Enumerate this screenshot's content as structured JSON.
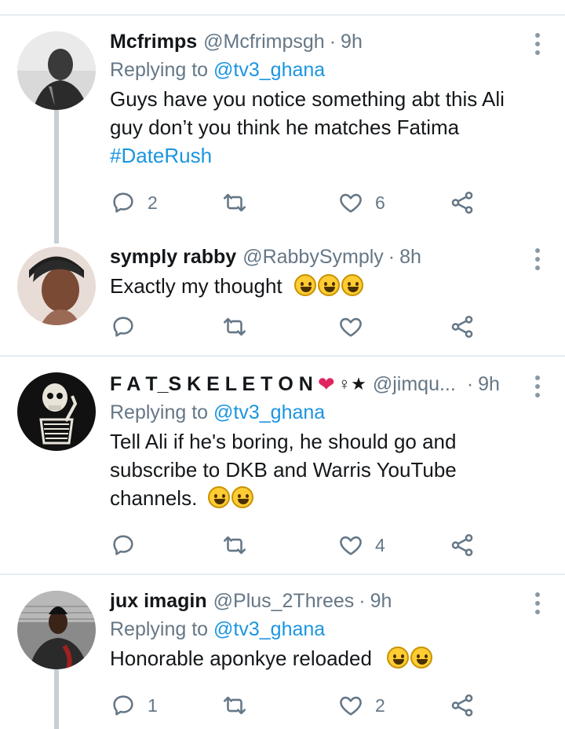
{
  "tweets": [
    {
      "name": "Mcfrimps",
      "handle": "@Mcfrimpsgh",
      "time": "9h",
      "reply_prefix": "Replying to",
      "reply_to": "@tv3_ghana",
      "text": "Guys have you notice something abt this Ali guy don’t you think he matches Fatima",
      "hashtag": "#DateRush",
      "replies": "2",
      "retweets": "",
      "likes": "6"
    },
    {
      "name": "symply rabby",
      "handle": "@RabbySymply",
      "time": "8h",
      "text": "Exactly my thought",
      "emojis": [
        "rofl",
        "rofl",
        "rofl"
      ],
      "replies": "",
      "retweets": "",
      "likes": ""
    },
    {
      "name": "F A T_S K E L E T O N",
      "name_symbols": "♀★",
      "handle": "@jimqu...",
      "time": "9h",
      "reply_prefix": "Replying to",
      "reply_to": "@tv3_ghana",
      "text_lines": [
        "Tell Ali if he's boring, he should go and",
        "subscribe to DKB and Warris YouTube",
        "channels."
      ],
      "emojis": [
        "rofl",
        "rofl"
      ],
      "replies": "",
      "retweets": "",
      "likes": "4"
    },
    {
      "name": "jux imagin",
      "handle": "@Plus_2Threes",
      "time": "9h",
      "reply_prefix": "Replying to",
      "reply_to": "@tv3_ghana",
      "text": "Honorable aponkye reloaded",
      "emojis": [
        "smiley",
        "smiley"
      ],
      "replies": "1",
      "retweets": "",
      "likes": "2"
    }
  ],
  "icons": {
    "reply": "speech-bubble-icon",
    "retweet": "retweet-icon",
    "like": "heart-icon",
    "share": "share-icon",
    "more": "more-vertical-icon"
  },
  "colors": {
    "link": "#1b95e0",
    "secondary": "#657786",
    "divider": "#e6ecf0",
    "heart": "#e0245e"
  }
}
